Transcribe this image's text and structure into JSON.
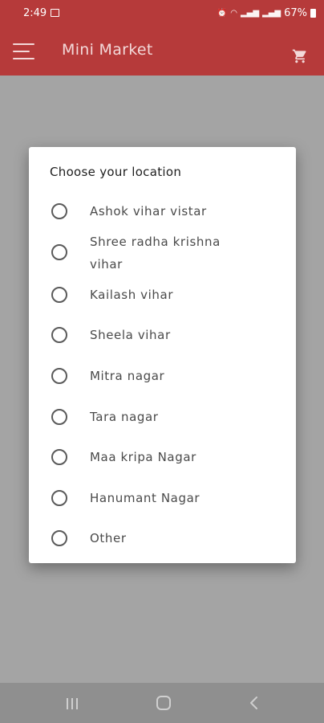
{
  "status": {
    "time": "2:49",
    "battery": "67%"
  },
  "app": {
    "title": "Mini Market",
    "menu_icon": "hamburger-icon",
    "cart_icon": "cart-icon",
    "bar_color": "#b63a3a"
  },
  "dialog": {
    "title": "Choose your location",
    "options": [
      "Ashok vihar vistar",
      "Shree radha krishna vihar",
      "Kailash vihar",
      "Sheela vihar",
      "Mitra nagar",
      "Tara nagar",
      "Maa kripa Nagar",
      "Hanumant Nagar",
      "Other"
    ]
  },
  "navbar": {
    "recent_icon": "recent-apps-icon",
    "home_icon": "home-icon",
    "back_icon": "back-icon"
  }
}
